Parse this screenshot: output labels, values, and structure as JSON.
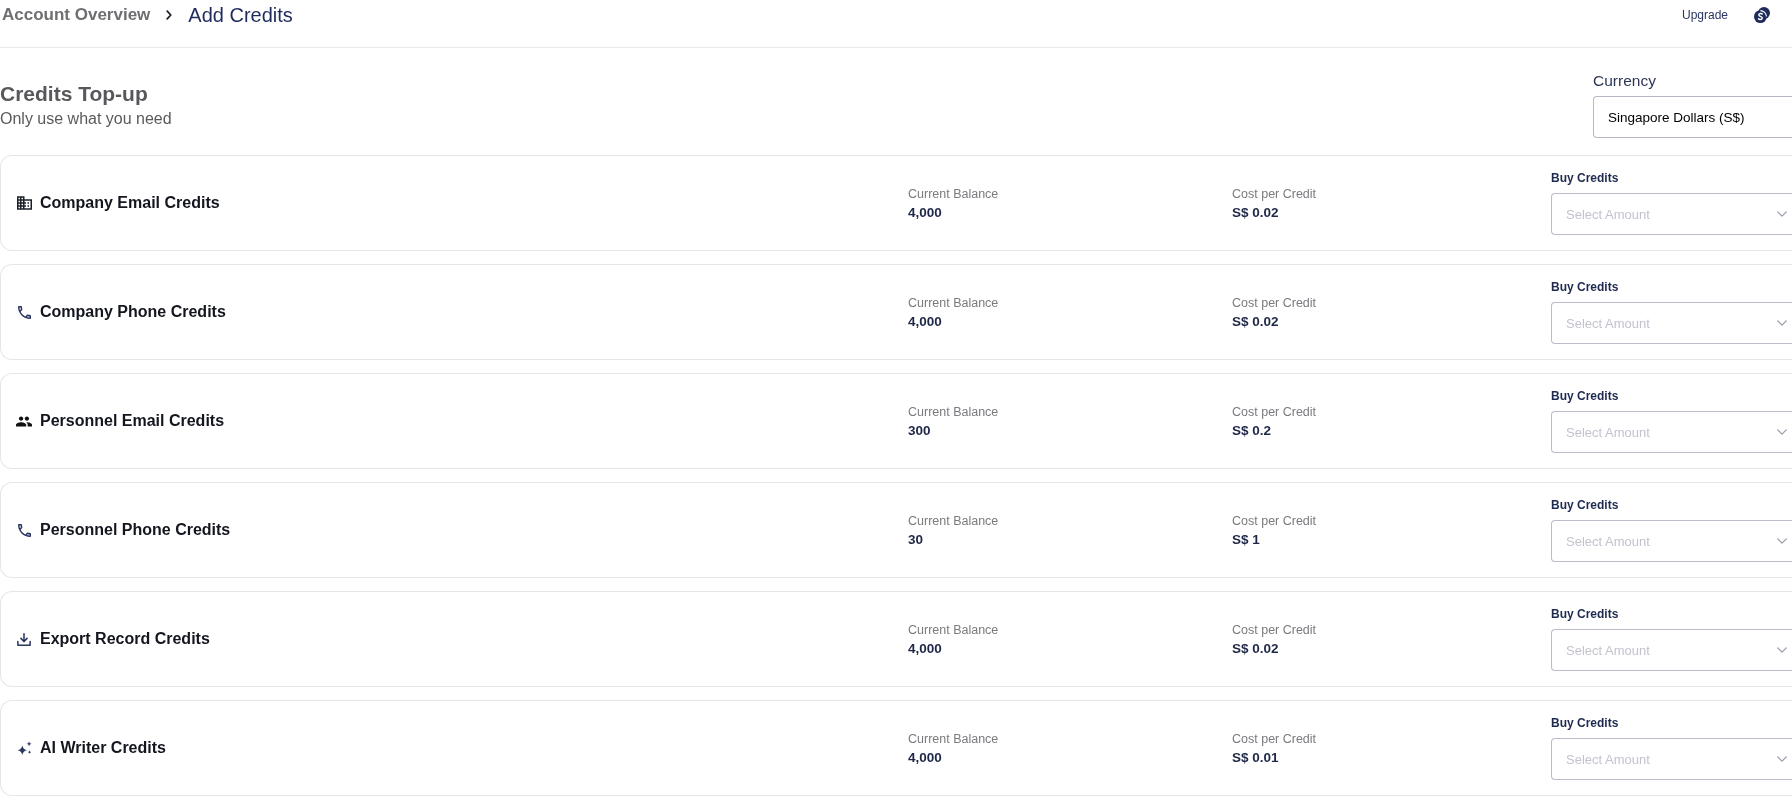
{
  "top_bar": {
    "breadcrumb": [
      {
        "label": "Account Overview",
        "current": false
      },
      {
        "label": "Add Credits",
        "current": true
      }
    ],
    "upgrade": "Upgrade"
  },
  "section": {
    "title": "Credits Top-up",
    "subtitle": "Only use what you need"
  },
  "currency": {
    "label": "Currency",
    "value": "Singapore Dollars (S$)"
  },
  "credits": [
    {
      "kind": "building",
      "title": "Company Email Credits",
      "balance_label": "Current Balance",
      "balance": "4,000",
      "cost_label": "Cost per Credit",
      "cost": "S$ 0.02",
      "buy_label": "Buy Credits",
      "placeholder": "Select Amount"
    },
    {
      "kind": "phone",
      "title": "Company Phone Credits",
      "balance_label": "Current Balance",
      "balance": "4,000",
      "cost_label": "Cost per Credit",
      "cost": "S$ 0.02",
      "buy_label": "Buy Credits",
      "placeholder": "Select Amount"
    },
    {
      "kind": "people",
      "title": "Personnel Email Credits",
      "balance_label": "Current Balance",
      "balance": "300",
      "cost_label": "Cost per Credit",
      "cost": "S$ 0.2",
      "buy_label": "Buy Credits",
      "placeholder": "Select Amount"
    },
    {
      "kind": "phone",
      "title": "Personnel Phone Credits",
      "balance_label": "Current Balance",
      "balance": "30",
      "cost_label": "Cost per Credit",
      "cost": "S$ 1",
      "buy_label": "Buy Credits",
      "placeholder": "Select Amount"
    },
    {
      "kind": "download",
      "title": "Export Record Credits",
      "balance_label": "Current Balance",
      "balance": "4,000",
      "cost_label": "Cost per Credit",
      "cost": "S$ 0.02",
      "buy_label": "Buy Credits",
      "placeholder": "Select Amount"
    },
    {
      "kind": "sparkle",
      "title": "AI Writer Credits",
      "balance_label": "Current Balance",
      "balance": "4,000",
      "cost_label": "Cost per Credit",
      "cost": "S$ 0.01",
      "buy_label": "Buy Credits",
      "placeholder": "Select Amount"
    }
  ]
}
